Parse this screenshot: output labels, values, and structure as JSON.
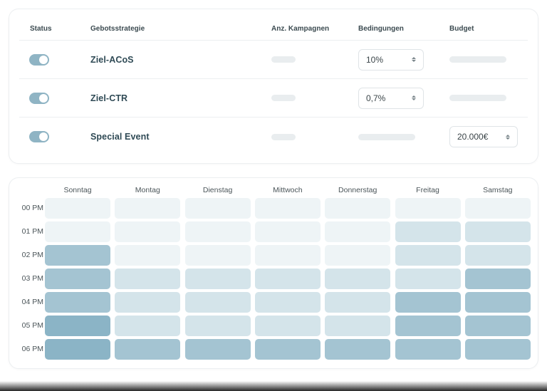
{
  "strategy_table": {
    "headers": {
      "status": "Status",
      "strategy": "Gebotsstrategie",
      "campaigns": "Anz. Kampagnen",
      "conditions": "Bedingungen",
      "budget": "Budget"
    },
    "rows": [
      {
        "name": "Ziel-ACoS",
        "status_on": true,
        "condition_value": "10%",
        "budget_value": ""
      },
      {
        "name": "Ziel-CTR",
        "status_on": true,
        "condition_value": "0,7%",
        "budget_value": ""
      },
      {
        "name": "Special Event",
        "status_on": true,
        "condition_value": "",
        "budget_value": "20.000€"
      }
    ]
  },
  "heatmap": {
    "days": [
      "Sonntag",
      "Montag",
      "Dienstag",
      "Mittwoch",
      "Donnerstag",
      "Freitag",
      "Samstag"
    ],
    "hours": [
      "00 PM",
      "01 PM",
      "02 PM",
      "03 PM",
      "04 PM",
      "05 PM",
      "06 PM"
    ],
    "intensity": [
      [
        0,
        0,
        0,
        0,
        0,
        0,
        0
      ],
      [
        0,
        0,
        0,
        0,
        0,
        1,
        1
      ],
      [
        3,
        0,
        0,
        0,
        0,
        1,
        1
      ],
      [
        3,
        1,
        1,
        1,
        1,
        1,
        3
      ],
      [
        3,
        1,
        1,
        1,
        1,
        3,
        3
      ],
      [
        4,
        1,
        1,
        1,
        1,
        3,
        3
      ],
      [
        4,
        3,
        3,
        3,
        3,
        3,
        3
      ]
    ],
    "palette": [
      "#eef4f6",
      "#d4e4ea",
      "#c4d9e1",
      "#a4c4d2",
      "#8bb4c6"
    ]
  }
}
